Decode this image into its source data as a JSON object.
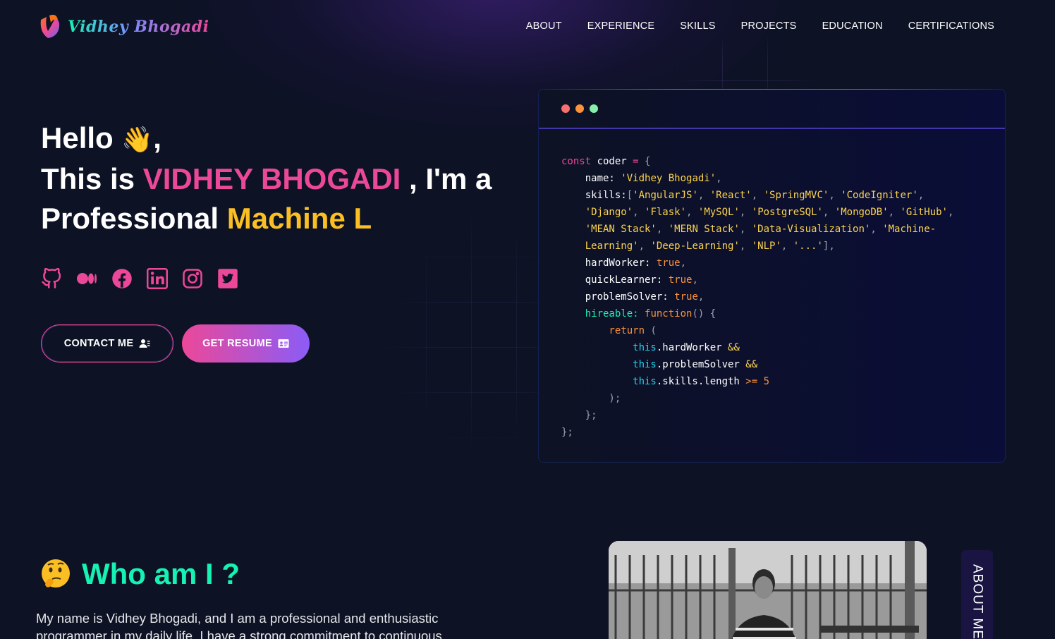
{
  "header": {
    "logo_text": "Vidhey Bhogadi",
    "nav": [
      {
        "label": "ABOUT"
      },
      {
        "label": "EXPERIENCE"
      },
      {
        "label": "SKILLS"
      },
      {
        "label": "PROJECTS"
      },
      {
        "label": "EDUCATION"
      },
      {
        "label": "CERTIFICATIONS"
      }
    ]
  },
  "hero": {
    "hello": "Hello",
    "wave_emoji": "👋",
    "comma": ",",
    "this_is": "This is",
    "name": "VIDHEY BHOGADI",
    "im_a": ", I'm a",
    "professional": "Professional",
    "role_typed": "Machine L"
  },
  "socials": [
    {
      "name": "github-icon"
    },
    {
      "name": "medium-icon"
    },
    {
      "name": "facebook-icon"
    },
    {
      "name": "linkedin-icon"
    },
    {
      "name": "instagram-icon"
    },
    {
      "name": "twitter-icon"
    }
  ],
  "buttons": {
    "contact": "CONTACT ME",
    "resume": "GET RESUME"
  },
  "code": {
    "lines": [
      [
        {
          "t": "const ",
          "c": "k-pink"
        },
        {
          "t": "coder ",
          "c": ""
        },
        {
          "t": "= ",
          "c": "k-pink"
        },
        {
          "t": "{",
          "c": "k-gray"
        }
      ],
      [
        {
          "t": "    name: ",
          "c": ""
        },
        {
          "t": "'Vidhey Bhogadi'",
          "c": "k-amber"
        },
        {
          "t": ",",
          "c": "k-gray"
        }
      ],
      [
        {
          "t": "    skills:",
          "c": ""
        },
        {
          "t": "[",
          "c": "k-gray"
        },
        {
          "t": "'AngularJS'",
          "c": "k-amber"
        },
        {
          "t": ", ",
          "c": "k-gray"
        },
        {
          "t": "'React'",
          "c": "k-amber"
        },
        {
          "t": ", ",
          "c": "k-gray"
        },
        {
          "t": "'SpringMVC'",
          "c": "k-amber"
        },
        {
          "t": ", ",
          "c": "k-gray"
        },
        {
          "t": "'CodeIgniter'",
          "c": "k-amber"
        },
        {
          "t": ",",
          "c": "k-gray"
        }
      ],
      [
        {
          "t": "    ",
          "c": ""
        },
        {
          "t": "'Django'",
          "c": "k-amber"
        },
        {
          "t": ", ",
          "c": "k-gray"
        },
        {
          "t": "'Flask'",
          "c": "k-amber"
        },
        {
          "t": ", ",
          "c": "k-gray"
        },
        {
          "t": "'MySQL'",
          "c": "k-amber"
        },
        {
          "t": ", ",
          "c": "k-gray"
        },
        {
          "t": "'PostgreSQL'",
          "c": "k-amber"
        },
        {
          "t": ", ",
          "c": "k-gray"
        },
        {
          "t": "'MongoDB'",
          "c": "k-amber"
        },
        {
          "t": ", ",
          "c": "k-gray"
        },
        {
          "t": "'GitHub'",
          "c": "k-amber"
        },
        {
          "t": ",",
          "c": "k-gray"
        }
      ],
      [
        {
          "t": "    ",
          "c": ""
        },
        {
          "t": "'MEAN Stack'",
          "c": "k-amber"
        },
        {
          "t": ", ",
          "c": "k-gray"
        },
        {
          "t": "'MERN Stack'",
          "c": "k-amber"
        },
        {
          "t": ", ",
          "c": "k-gray"
        },
        {
          "t": "'Data-Visualization'",
          "c": "k-amber"
        },
        {
          "t": ", ",
          "c": "k-gray"
        },
        {
          "t": "'Machine-",
          "c": "k-amber"
        }
      ],
      [
        {
          "t": "    ",
          "c": ""
        },
        {
          "t": "Learning'",
          "c": "k-amber"
        },
        {
          "t": ", ",
          "c": "k-gray"
        },
        {
          "t": "'Deep-Learning'",
          "c": "k-amber"
        },
        {
          "t": ", ",
          "c": "k-gray"
        },
        {
          "t": "'NLP'",
          "c": "k-amber"
        },
        {
          "t": ", ",
          "c": "k-gray"
        },
        {
          "t": "'...'",
          "c": "k-amber"
        },
        {
          "t": "],",
          "c": "k-gray"
        }
      ],
      [
        {
          "t": "    hardWorker: ",
          "c": ""
        },
        {
          "t": "true",
          "c": "k-orange"
        },
        {
          "t": ",",
          "c": "k-gray"
        }
      ],
      [
        {
          "t": "    quickLearner: ",
          "c": ""
        },
        {
          "t": "true",
          "c": "k-orange"
        },
        {
          "t": ",",
          "c": "k-gray"
        }
      ],
      [
        {
          "t": "    problemSolver: ",
          "c": ""
        },
        {
          "t": "true",
          "c": "k-orange"
        },
        {
          "t": ",",
          "c": "k-gray"
        }
      ],
      [
        {
          "t": "    hireable: ",
          "c": "k-green"
        },
        {
          "t": "function",
          "c": "k-orange"
        },
        {
          "t": "() {",
          "c": "k-gray"
        }
      ],
      [
        {
          "t": "        return ",
          "c": "k-orange"
        },
        {
          "t": "(",
          "c": "k-gray"
        }
      ],
      [
        {
          "t": "            this",
          "c": "k-cyan"
        },
        {
          "t": ".hardWorker ",
          "c": ""
        },
        {
          "t": "&&",
          "c": "k-amber"
        }
      ],
      [
        {
          "t": "            this",
          "c": "k-cyan"
        },
        {
          "t": ".problemSolver ",
          "c": ""
        },
        {
          "t": "&&",
          "c": "k-amber"
        }
      ],
      [
        {
          "t": "            this",
          "c": "k-cyan"
        },
        {
          "t": ".skills.length ",
          "c": ""
        },
        {
          "t": ">= 5",
          "c": "k-orange"
        }
      ],
      [
        {
          "t": "        );",
          "c": "k-gray"
        }
      ],
      [
        {
          "t": "    };",
          "c": "k-gray"
        }
      ],
      [
        {
          "t": "};",
          "c": "k-gray"
        }
      ]
    ]
  },
  "about": {
    "emoji": "🤔",
    "heading": "Who am I ?",
    "text": "My name is Vidhey Bhogadi, and I am a professional and enthusiastic programmer in my daily life. I have a strong commitment to continuous",
    "tab_label": "ABOUT ME"
  },
  "colors": {
    "background": "#0d1224",
    "accent_pink": "#ec4899",
    "accent_amber": "#fbbf24",
    "accent_green": "#16f2b3",
    "accent_violet": "#8b5cf6"
  }
}
